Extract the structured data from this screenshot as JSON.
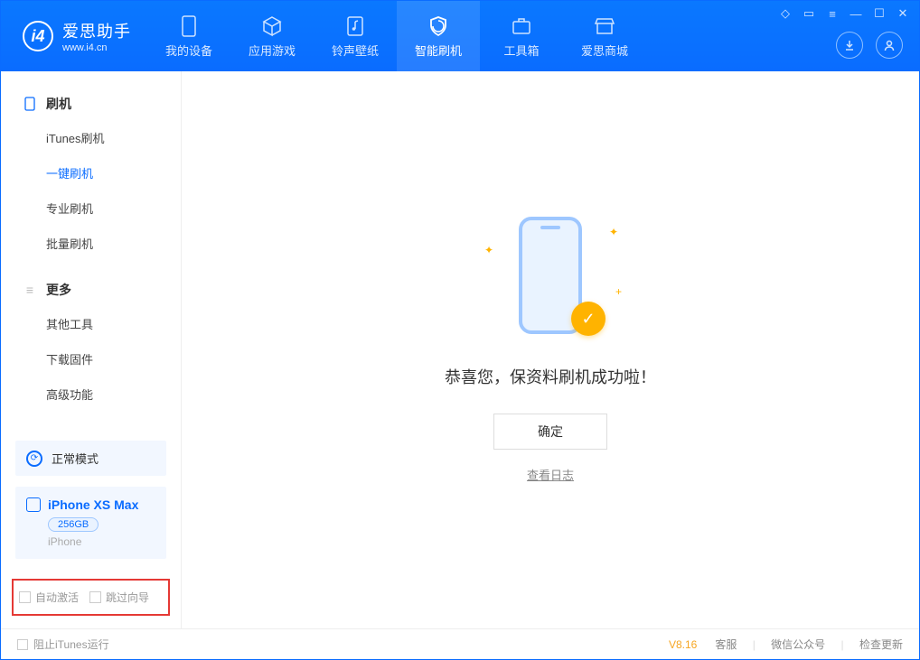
{
  "app": {
    "title": "爱思助手",
    "subtitle": "www.i4.cn"
  },
  "tabs": [
    {
      "label": "我的设备",
      "icon": "device"
    },
    {
      "label": "应用游戏",
      "icon": "cube"
    },
    {
      "label": "铃声壁纸",
      "icon": "music"
    },
    {
      "label": "智能刷机",
      "icon": "shield",
      "active": true
    },
    {
      "label": "工具箱",
      "icon": "briefcase"
    },
    {
      "label": "爱思商城",
      "icon": "store"
    }
  ],
  "sidebar": {
    "sections": [
      {
        "title": "刷机",
        "icon": "phone",
        "items": [
          {
            "label": "iTunes刷机"
          },
          {
            "label": "一键刷机",
            "active": true
          },
          {
            "label": "专业刷机"
          },
          {
            "label": "批量刷机"
          }
        ]
      },
      {
        "title": "更多",
        "icon": "menu",
        "items": [
          {
            "label": "其他工具"
          },
          {
            "label": "下载固件"
          },
          {
            "label": "高级功能"
          }
        ]
      }
    ],
    "status": {
      "label": "正常模式"
    },
    "device": {
      "name": "iPhone XS Max",
      "capacity": "256GB",
      "type": "iPhone"
    },
    "checks": {
      "auto_activate": "自动激活",
      "skip_guide": "跳过向导"
    }
  },
  "content": {
    "success_text": "恭喜您，保资料刷机成功啦！",
    "ok_label": "确定",
    "log_link": "查看日志"
  },
  "footer": {
    "block_itunes": "阻止iTunes运行",
    "version": "V8.16",
    "links": [
      "客服",
      "微信公众号",
      "检查更新"
    ]
  }
}
